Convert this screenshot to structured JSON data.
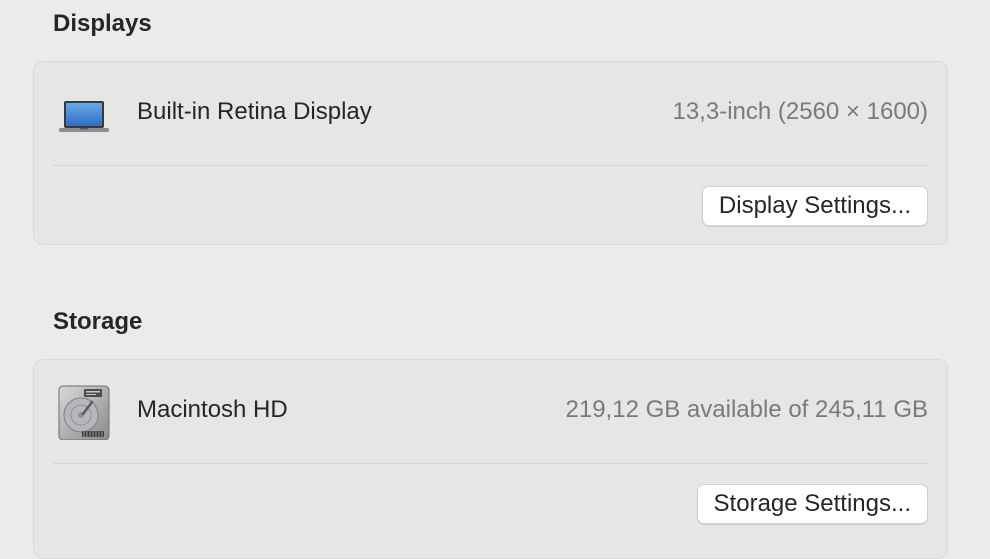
{
  "displays": {
    "title": "Displays",
    "item": {
      "icon": "laptop-icon",
      "label": "Built-in Retina Display",
      "value": "13,3-inch (2560 × 1600)"
    },
    "button_label": "Display Settings..."
  },
  "storage": {
    "title": "Storage",
    "item": {
      "icon": "hard-drive-icon",
      "label": "Macintosh HD",
      "value": "219,12 GB available of 245,11 GB"
    },
    "button_label": "Storage Settings..."
  },
  "colors": {
    "background": "#edebe9",
    "group_background": "#e8e6e4",
    "secondary_text": "#7b7a79",
    "button_background": "#ffffff"
  }
}
